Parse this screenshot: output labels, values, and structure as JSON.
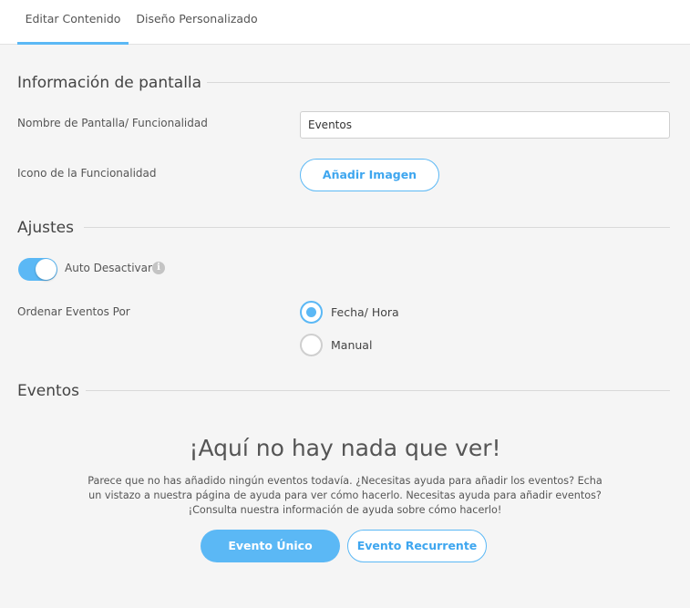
{
  "tabs": [
    {
      "label": "Editar Contenido",
      "active": true
    },
    {
      "label": "Diseño Personalizado",
      "active": false
    }
  ],
  "screen_info": {
    "title": "Información de pantalla",
    "name_label": "Nombre de Pantalla/ Funcionalidad",
    "name_value": "Eventos",
    "icon_label": "Icono de la Funcionalidad",
    "add_image_button": "Añadir Imagen"
  },
  "settings": {
    "title": "Ajustes",
    "auto_deactivate_label": "Auto Desactivar",
    "auto_deactivate_on": true,
    "info_icon": "i",
    "order_label": "Ordenar Eventos Por",
    "order_options": [
      {
        "label": "Fecha/ Hora",
        "selected": true
      },
      {
        "label": "Manual",
        "selected": false
      }
    ]
  },
  "events": {
    "title": "Eventos",
    "empty_title": "¡Aquí no hay nada que ver!",
    "empty_description": "Parece que no has añadido ningún eventos todavía. ¿Necesitas ayuda para añadir los eventos? Echa un vistazo a nuestra página de ayuda para ver cómo hacerlo. Necesitas ayuda para añadir eventos? ¡Consulta nuestra información de ayuda sobre cómo hacerlo!",
    "single_event_button": "Evento Único",
    "recurring_event_button": "Evento Recurrente"
  },
  "colors": {
    "accent": "#5bb8f5",
    "background": "#f5f5f5",
    "text": "#555555"
  }
}
